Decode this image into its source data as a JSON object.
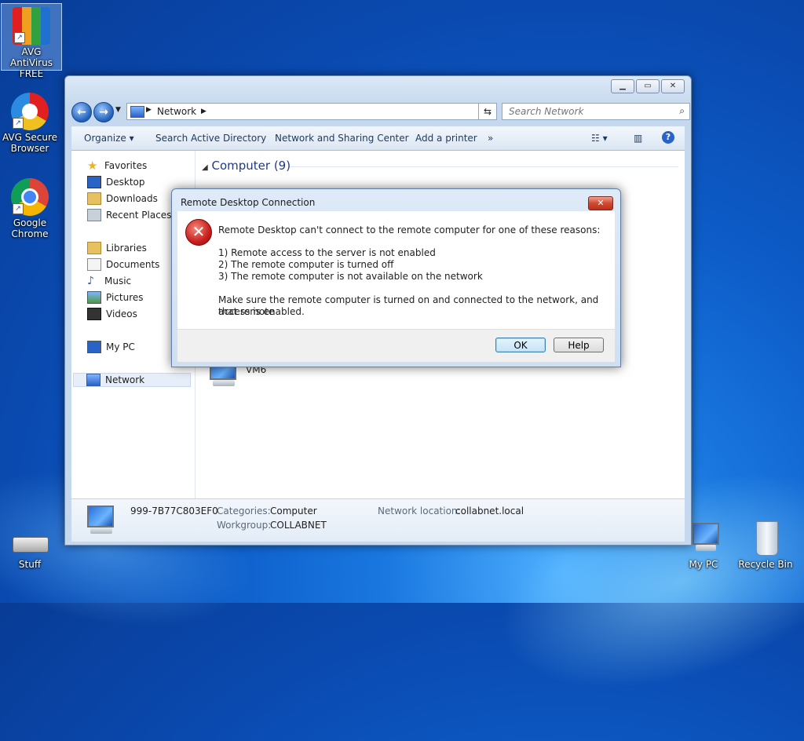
{
  "desktop": {
    "icons": [
      {
        "label": "AVG AntiVirus FREE",
        "icon": "avg-antivirus-icon"
      },
      {
        "label": "AVG Secure Browser",
        "icon": "avg-browser-icon"
      },
      {
        "label": "Google Chrome",
        "icon": "chrome-icon"
      },
      {
        "label": "Stuff",
        "icon": "drive-icon"
      },
      {
        "label": "My PC",
        "icon": "computer-icon"
      },
      {
        "label": "Recycle Bin",
        "icon": "recycle-bin-icon"
      }
    ]
  },
  "explorer": {
    "address": "Network",
    "search_placeholder": "Search Network",
    "toolbar": {
      "organize": "Organize",
      "search_ad": "Search Active Directory",
      "network_sharing": "Network and Sharing Center",
      "add_printer": "Add a printer",
      "more": "»"
    },
    "nav": {
      "favorites": "Favorites",
      "desktop": "Desktop",
      "downloads": "Downloads",
      "recent": "Recent Places",
      "libraries": "Libraries",
      "documents": "Documents",
      "music": "Music",
      "pictures": "Pictures",
      "videos": "Videos",
      "mypc": "My PC",
      "network": "Network"
    },
    "group_label": "Computer (9)",
    "visible_item": "VM6",
    "details": {
      "name": "999-7B77C803EF0",
      "categories_label": "Categories:",
      "categories_value": "Computer",
      "workgroup_label": "Workgroup:",
      "workgroup_value": "COLLABNET",
      "location_label": "Network location:",
      "location_value": "collabnet.local"
    }
  },
  "dialog": {
    "title": "Remote Desktop Connection",
    "message": "Remote Desktop can't connect to the remote computer for one of these reasons:",
    "reasons": [
      "1) Remote access to the server is not enabled",
      "2) The remote computer is turned off",
      "3) The remote computer is not available on the network"
    ],
    "advice_line1": "Make sure the remote computer is turned on and connected to the network, and that remote",
    "advice_line2": "access is enabled.",
    "ok_label": "OK",
    "help_label": "Help"
  },
  "colors": {
    "desktop_blue": "#0d5cc8",
    "error_red": "#c81e1e",
    "link_blue": "#1e3a8a"
  }
}
